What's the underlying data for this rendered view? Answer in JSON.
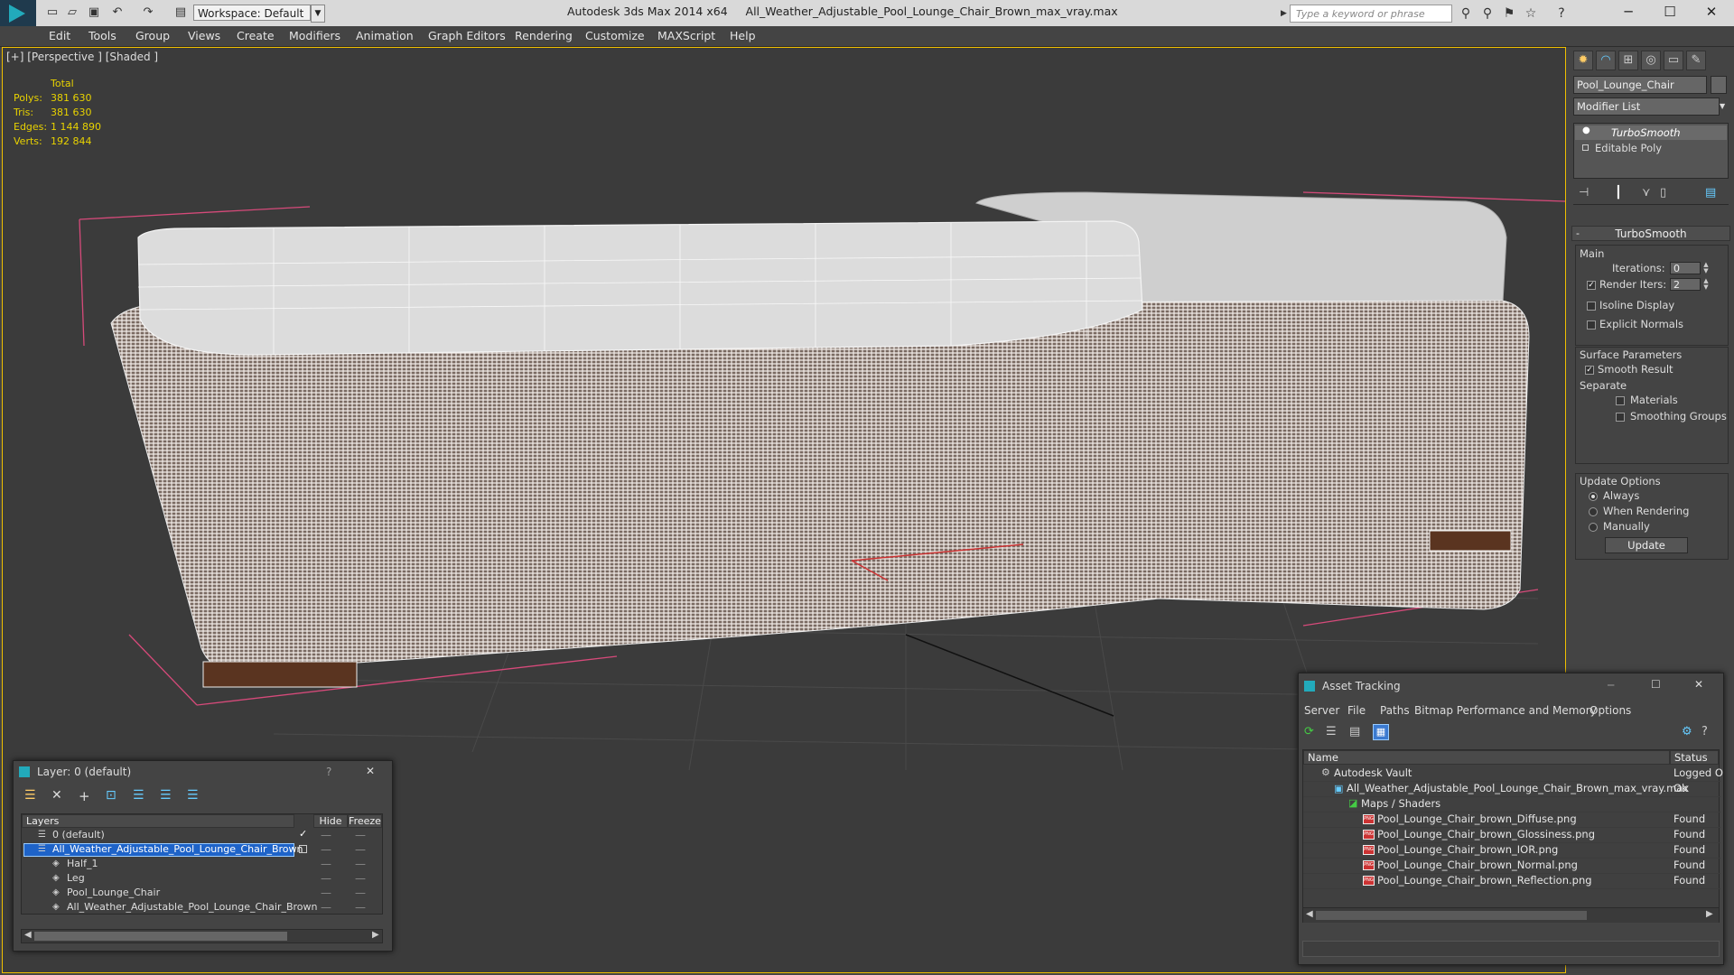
{
  "titlebar": {
    "workspace_label": "Workspace: Default",
    "app_name": "Autodesk 3ds Max  2014 x64",
    "file_name": "All_Weather_Adjustable_Pool_Lounge_Chair_Brown_max_vray.max",
    "search_placeholder": "Type a keyword or phrase"
  },
  "menu": [
    "Edit",
    "Tools",
    "Group",
    "Views",
    "Create",
    "Modifiers",
    "Animation",
    "Graph Editors",
    "Rendering",
    "Customize",
    "MAXScript",
    "Help"
  ],
  "viewport": {
    "label": "[+] [Perspective ] [Shaded ]",
    "stats": {
      "header": "Total",
      "rows": [
        {
          "label": "Polys:",
          "value": "381 630"
        },
        {
          "label": "Tris:",
          "value": "381 630"
        },
        {
          "label": "Edges:",
          "value": "1 144 890"
        },
        {
          "label": "Verts:",
          "value": "192 844"
        }
      ]
    }
  },
  "command_panel": {
    "object_name": "Pool_Lounge_Chair",
    "modifier_list": "Modifier List",
    "stack": [
      "TurboSmooth",
      "Editable Poly"
    ],
    "rollout_title": "TurboSmooth",
    "main_group": "Main",
    "iterations_label": "Iterations:",
    "iterations_value": "0",
    "render_iters_label": "Render Iters:",
    "render_iters_value": "2",
    "isoline_label": "Isoline Display",
    "explicit_normals_label": "Explicit Normals",
    "surface_group": "Surface Parameters",
    "smooth_result_label": "Smooth Result",
    "separate_label": "Separate",
    "materials_label": "Materials",
    "smoothing_groups_label": "Smoothing Groups",
    "update_group": "Update Options",
    "always_label": "Always",
    "when_rendering_label": "When Rendering",
    "manually_label": "Manually",
    "update_button": "Update"
  },
  "layer_dialog": {
    "title": "Layer: 0 (default)",
    "help": "?",
    "close": "✕",
    "col_layers": "Layers",
    "col_hide": "Hide",
    "col_freeze": "Freeze",
    "rows": [
      {
        "name": "0 (default)"
      },
      {
        "name": "All_Weather_Adjustable_Pool_Lounge_Chair_Brown"
      },
      {
        "name": "Half_1"
      },
      {
        "name": "Leg"
      },
      {
        "name": "Pool_Lounge_Chair"
      },
      {
        "name": "All_Weather_Adjustable_Pool_Lounge_Chair_Brown"
      }
    ]
  },
  "asset_tracking": {
    "title": "Asset Tracking",
    "menus": [
      "Server",
      "File",
      "Paths",
      "Bitmap Performance and Memory",
      "Options"
    ],
    "col_name": "Name",
    "col_status": "Status",
    "rows": [
      {
        "name": "Autodesk Vault",
        "status": "Logged O"
      },
      {
        "name": "All_Weather_Adjustable_Pool_Lounge_Chair_Brown_max_vray.max",
        "status": "Ok"
      },
      {
        "name": "Maps / Shaders",
        "status": ""
      },
      {
        "name": "Pool_Lounge_Chair_brown_Diffuse.png",
        "status": "Found"
      },
      {
        "name": "Pool_Lounge_Chair_brown_Glossiness.png",
        "status": "Found"
      },
      {
        "name": "Pool_Lounge_Chair_brown_IOR.png",
        "status": "Found"
      },
      {
        "name": "Pool_Lounge_Chair_brown_Normal.png",
        "status": "Found"
      },
      {
        "name": "Pool_Lounge_Chair_brown_Reflection.png",
        "status": "Found"
      }
    ]
  }
}
